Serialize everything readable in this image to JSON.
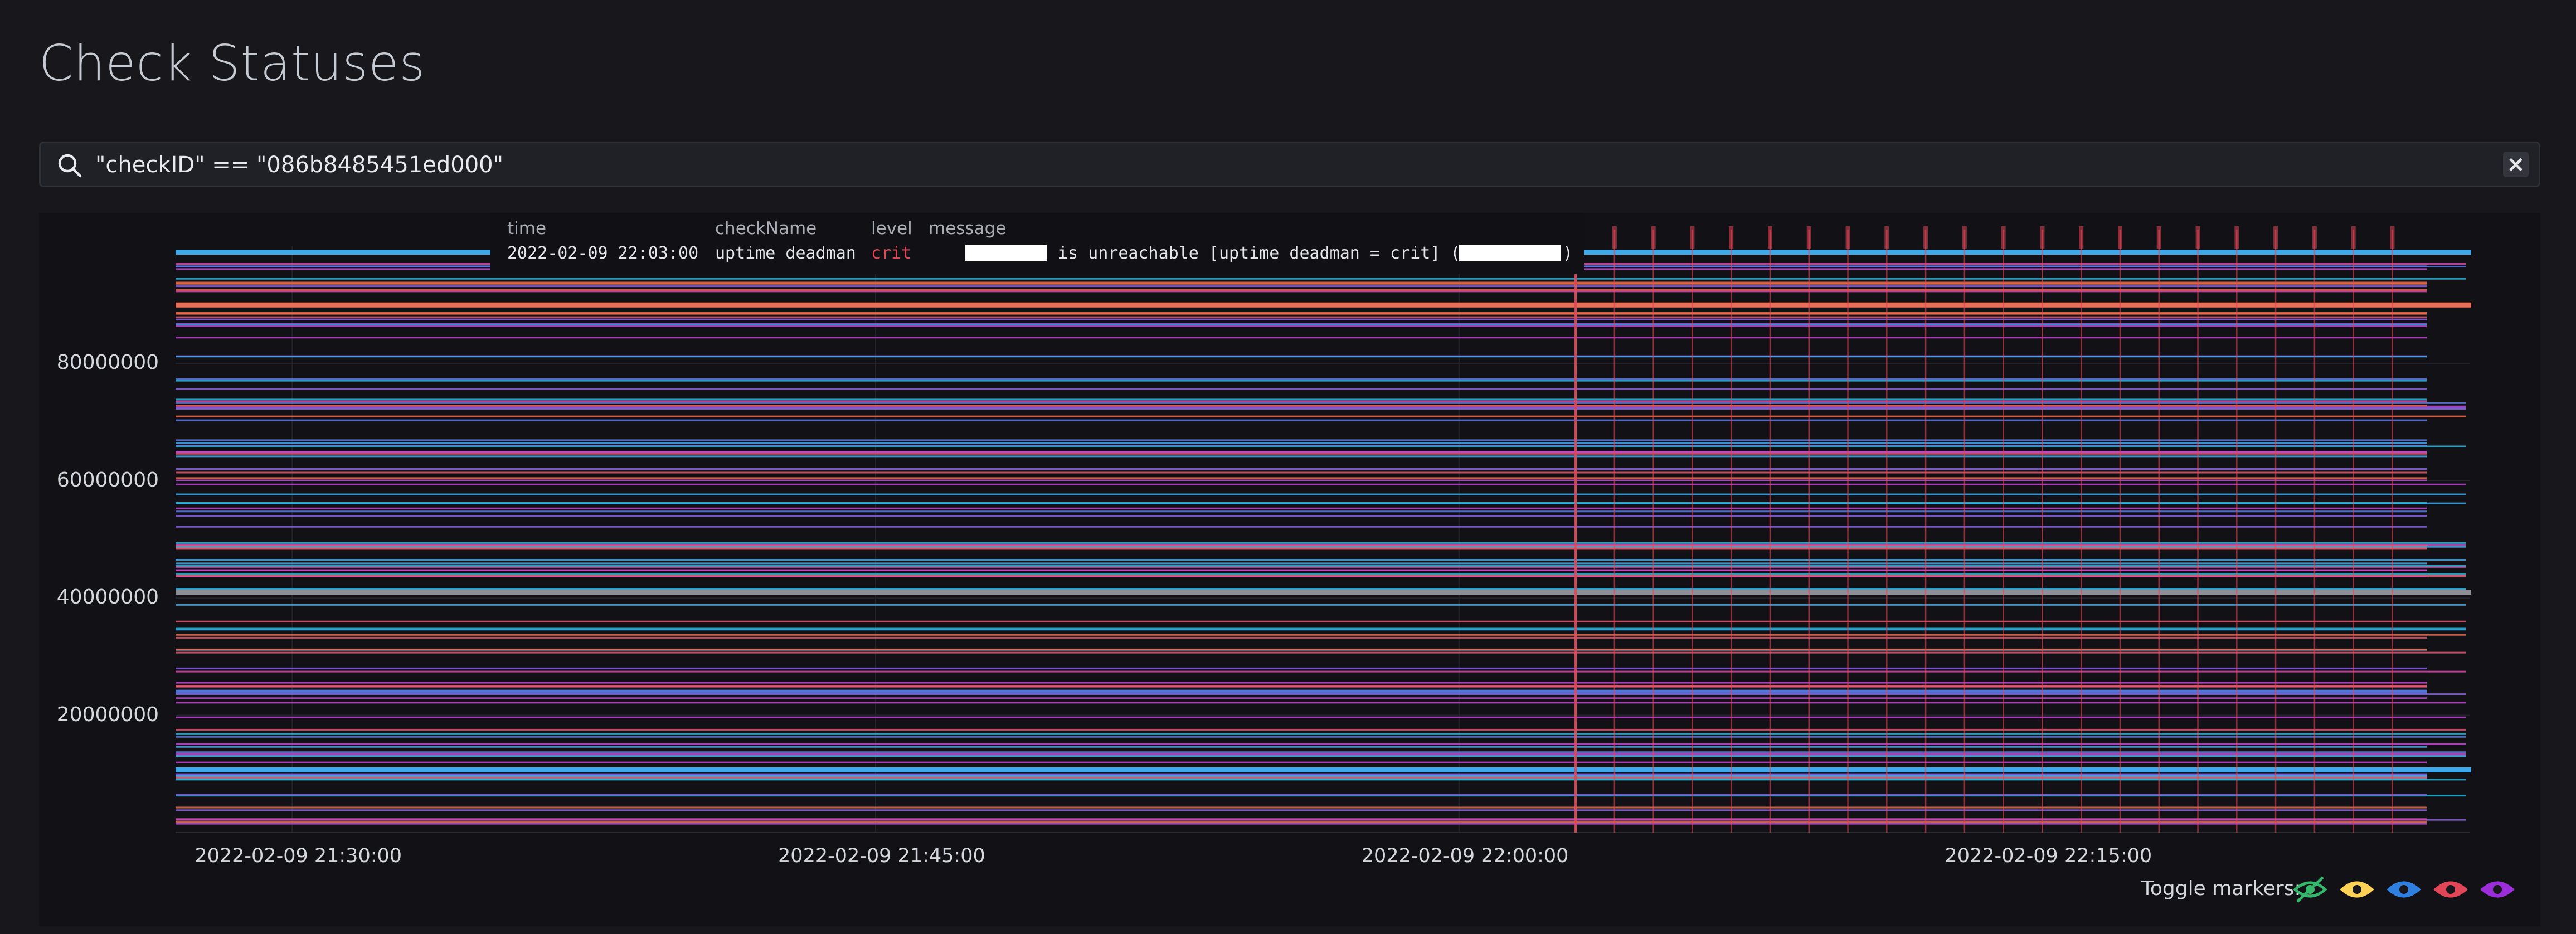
{
  "page": {
    "title": "Check Statuses"
  },
  "search": {
    "value": "\"checkID\" == \"086b8485451ed000\""
  },
  "tooltip": {
    "headers": {
      "time": "time",
      "checkName": "checkName",
      "level": "level",
      "message": "message"
    },
    "row": {
      "time": "2022-02-09 22:03:00",
      "checkName": "uptime deadman",
      "level": "crit",
      "message_text": "is unreachable [uptime deadman = crit] (",
      "message_close": ")"
    }
  },
  "toggle_markers": {
    "label": "Toggle markers:",
    "items": [
      {
        "name": "ok",
        "color": "#34b96c",
        "hidden": true
      },
      {
        "name": "info",
        "color": "#ffd255",
        "hidden": false
      },
      {
        "name": "warn",
        "color": "#2f7fe0",
        "hidden": false
      },
      {
        "name": "crit",
        "color": "#e24757",
        "hidden": false
      },
      {
        "name": "unknown",
        "color": "#9b2ed8",
        "hidden": false
      }
    ]
  },
  "colors": {
    "background": "#17171c",
    "panel": "#111116",
    "crit_marker": "#e24757"
  },
  "chart_data": {
    "type": "line",
    "x_unit": "time",
    "xlim": [
      "2022-02-09 21:27:00",
      "2022-02-09 22:26:00"
    ],
    "ylim": [
      0,
      100000000
    ],
    "x_ticks": [
      "2022-02-09 21:30:00",
      "2022-02-09 21:45:00",
      "2022-02-09 22:00:00",
      "2022-02-09 22:15:00"
    ],
    "y_ticks": [
      20000000,
      40000000,
      60000000,
      80000000
    ],
    "y_tick_labels": [
      "20000000",
      "40000000",
      "60000000",
      "80000000"
    ],
    "grid": true,
    "series_count": 120,
    "line_palette": [
      "#e05a6f",
      "#3fa8e8",
      "#8a63e8",
      "#c04ad0",
      "#f06b4a",
      "#5b7be6",
      "#d946a8",
      "#22b8e0"
    ],
    "highlight_lines": [
      {
        "y": 90000000,
        "color": "#e8705a"
      },
      {
        "y": 41000000,
        "color": "#8d8e96"
      },
      {
        "y": 10700000,
        "color": "#3fa8e8"
      },
      {
        "y": 99000000,
        "color": "#3fa8e8"
      }
    ],
    "status_markers": {
      "level": "crit",
      "first_time": "2022-02-09 22:03:00",
      "interval_minutes": 1,
      "count": 22
    }
  }
}
